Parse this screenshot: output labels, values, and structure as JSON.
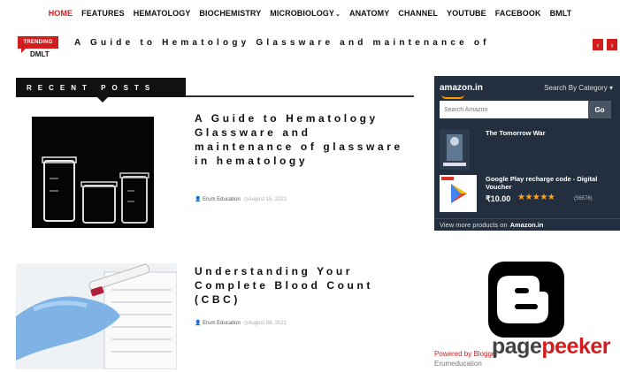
{
  "nav": {
    "items": [
      {
        "label": "HOME",
        "active": true
      },
      {
        "label": "FEATURES"
      },
      {
        "label": "HEMATOLOGY"
      },
      {
        "label": "BIOCHEMISTRY"
      },
      {
        "label": "MICROBIOLOGY",
        "dropdown": true
      },
      {
        "label": "ANATOMY"
      },
      {
        "label": "CHANNEL"
      },
      {
        "label": "YOUTUBE"
      },
      {
        "label": "FACEBOOK"
      },
      {
        "label": "BMLT"
      }
    ],
    "caret": "⌄"
  },
  "trending": {
    "badge": "TRENDING",
    "sub": "DMLT",
    "text": "A Guide to Hematology Glassware and maintenance of",
    "prev": "‹",
    "next": "›"
  },
  "recent": {
    "heading": "RECENT POSTS",
    "posts": [
      {
        "title": "A Guide to Hematology Glassware and maintenance of glassware in hematology",
        "author": "Erum Education",
        "date": "August 15, 2021",
        "image_icon": "lab-glassware-icon"
      },
      {
        "title": "Understanding Your Complete Blood Count (CBC)",
        "author": "Erum Education",
        "date": "August 08, 2021",
        "image_icon": "blood-test-icon"
      }
    ]
  },
  "amazon": {
    "logo": "amazon.in",
    "category": "Search By Category ▾",
    "search_placeholder": "Search Amazon",
    "go": "Go",
    "products": [
      {
        "title": "The Tomorrow War"
      },
      {
        "title": "Google Play recharge code - Digital Voucher",
        "price": "₹10.00",
        "stars": "★★★★★",
        "reviews": "(56576)"
      }
    ],
    "footer_prefix": "View more products on",
    "footer_link": "Amazon.in"
  },
  "blogger": {
    "powered": "Powered by Blogger",
    "name": "Erumeducation"
  },
  "watermark": {
    "part1": "page",
    "part2": "peeker"
  },
  "colors": {
    "accent": "#d11d1d",
    "amazon_bg": "#232f3e",
    "amazon_orange": "#ff9900"
  }
}
